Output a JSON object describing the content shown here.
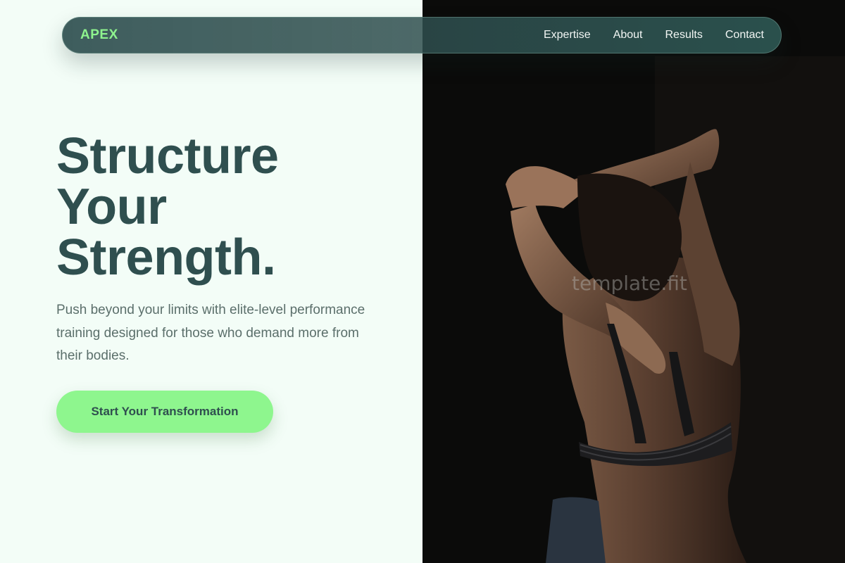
{
  "nav": {
    "logo": "APEX",
    "links": [
      {
        "label": "Expertise"
      },
      {
        "label": "About"
      },
      {
        "label": "Results"
      },
      {
        "label": "Contact"
      }
    ]
  },
  "hero": {
    "title_lines": [
      "Structure",
      "Your",
      "Strength."
    ],
    "subtitle": "Push beyond your limits with elite-level performance training designed for those who demand more from their bodies.",
    "cta_label": "Start Your Transformation"
  },
  "watermark": "template.fit",
  "colors": {
    "brand_dark": "#2f4f4f",
    "accent_green": "#8ef68e",
    "page_bg": "#f3fdf7"
  }
}
